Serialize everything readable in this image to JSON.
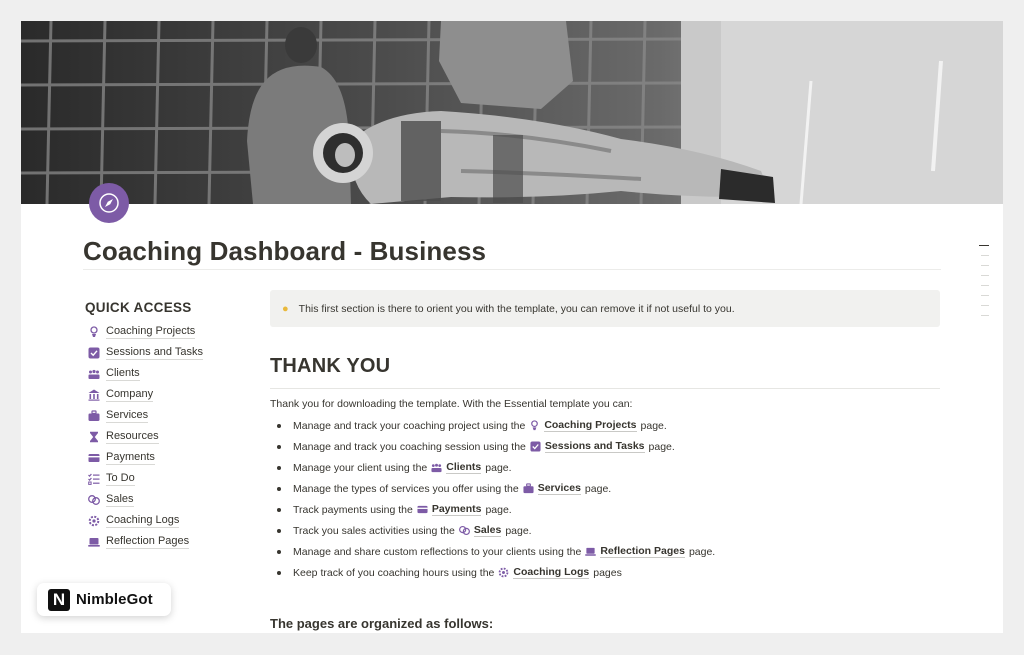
{
  "page": {
    "title": "Coaching Dashboard - Business",
    "accent_color": "#7d5ba6",
    "page_icon": "compass-icon",
    "cover": "black-and-white astronaut photo"
  },
  "quick_access": {
    "title": "QUICK ACCESS",
    "items": [
      {
        "label": "Coaching Projects",
        "icon": "lightbulb-person-icon"
      },
      {
        "label": "Sessions and Tasks",
        "icon": "checkbox-icon"
      },
      {
        "label": "Clients",
        "icon": "people-icon"
      },
      {
        "label": "Company",
        "icon": "building-icon"
      },
      {
        "label": "Services",
        "icon": "briefcase-icon"
      },
      {
        "label": "Resources",
        "icon": "hourglass-icon"
      },
      {
        "label": "Payments",
        "icon": "credit-card-icon"
      },
      {
        "label": "To Do",
        "icon": "checklist-icon"
      },
      {
        "label": "Sales",
        "icon": "coins-icon"
      },
      {
        "label": "Coaching Logs",
        "icon": "gear-icon"
      },
      {
        "label": "Reflection Pages",
        "icon": "laptop-icon"
      }
    ]
  },
  "callout": {
    "icon": "lightbulb-icon",
    "text": "This first section is there to orient you with the template, you can remove it if not useful to you."
  },
  "thank_you": {
    "heading": "THANK YOU",
    "intro": "Thank you for downloading the template. With the Essential template you can:",
    "items": [
      {
        "pre": "Manage and track your coaching project using the",
        "link": "Coaching Projects",
        "post": "page."
      },
      {
        "pre": "Manage and track you coaching session using the",
        "link": "Sessions and Tasks",
        "post": "page."
      },
      {
        "pre": "Manage your client using the",
        "link": "Clients",
        "post": "page."
      },
      {
        "pre": "Manage the types of services you offer using the",
        "link": "Services",
        "post": "page."
      },
      {
        "pre": "Track payments using the",
        "link": "Payments",
        "post": "page."
      },
      {
        "pre": "Track you sales activities using the",
        "link": "Sales",
        "post": "page."
      },
      {
        "pre": "Manage and share custom reflections to your clients using the",
        "link": "Reflection Pages",
        "post": "page."
      },
      {
        "pre": "Keep track of you coaching hours using the",
        "link": "Coaching Logs",
        "post": "pages"
      }
    ]
  },
  "organized_heading": "The pages are organized as follows:",
  "watermark": {
    "letter": "N",
    "name": "NimbleGot"
  }
}
